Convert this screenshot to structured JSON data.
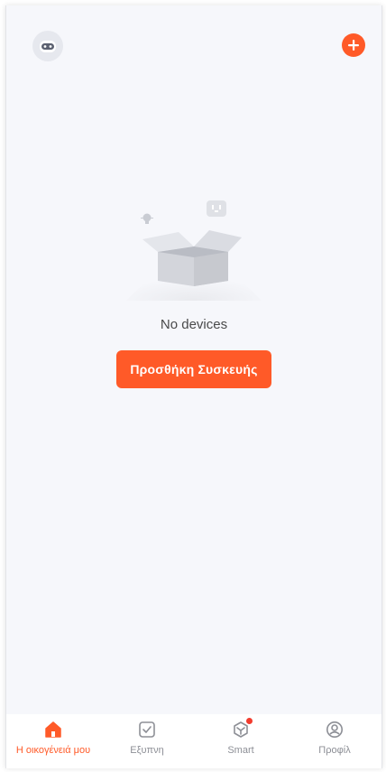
{
  "header": {
    "avatar_icon": "robot-face-icon",
    "add_icon": "plus-circle-icon"
  },
  "empty_state": {
    "illustration": "empty-box-icon",
    "message": "No devices",
    "add_device_label": "Προσθήκη Συσκευής"
  },
  "bottom_nav": {
    "items": [
      {
        "label": "Η οικογένειά μου",
        "icon": "home-icon",
        "active": true
      },
      {
        "label": "Εξυπνη",
        "icon": "checkbox-icon",
        "active": false
      },
      {
        "label": "Smart",
        "icon": "cube-icon",
        "active": false,
        "badge": true
      },
      {
        "label": "Προφίλ",
        "icon": "profile-icon",
        "active": false
      }
    ]
  },
  "colors": {
    "accent": "#ff5a28",
    "background": "#f6f7fb",
    "inactive_text": "#8d8f96"
  }
}
